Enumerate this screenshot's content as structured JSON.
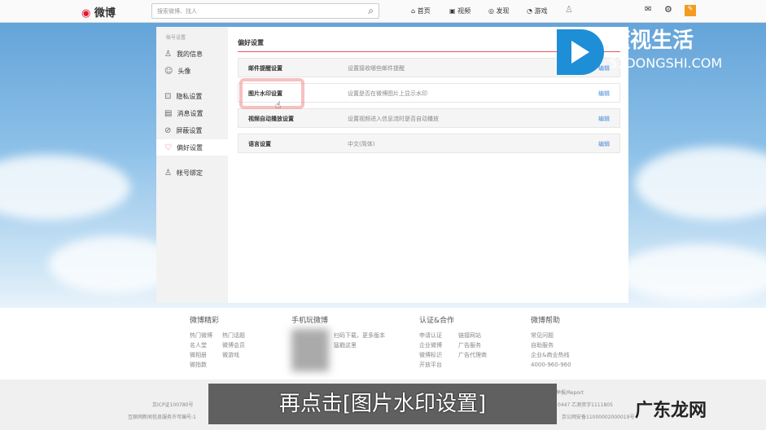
{
  "header": {
    "logo": "微博",
    "search_placeholder": "搜索微博、找人",
    "nav": [
      "首页",
      "视频",
      "发现",
      "游戏"
    ]
  },
  "sidebar": {
    "heading": "帐号设置",
    "items": [
      {
        "label": "我的信息",
        "icon": "user-icon"
      },
      {
        "label": "头像",
        "icon": "avatar-icon"
      },
      {
        "label": "隐私设置",
        "icon": "lock-icon"
      },
      {
        "label": "消息设置",
        "icon": "message-icon"
      },
      {
        "label": "屏蔽设置",
        "icon": "block-icon"
      },
      {
        "label": "偏好设置",
        "icon": "heart-icon"
      },
      {
        "label": "帐号绑定",
        "icon": "user-icon"
      }
    ]
  },
  "main": {
    "title": "偏好设置",
    "rows": [
      {
        "name": "邮件提醒设置",
        "desc": "设置接收哪些邮件提醒",
        "edit": "编辑"
      },
      {
        "name": "图片水印设置",
        "desc": "设置是否在微博图片上显示水印",
        "edit": "编辑"
      },
      {
        "name": "视频自动播放设置",
        "desc": "设置视频进入信息流时是否自动播放",
        "edit": "编辑"
      },
      {
        "name": "语言设置",
        "desc": "中文(简体)",
        "edit": "编辑"
      }
    ]
  },
  "footer": {
    "cols": [
      {
        "title": "微博精彩",
        "links": [
          "热门微博",
          "热门话题",
          "名人堂",
          "微博会员",
          "微相册",
          "微游戏",
          "微指数"
        ]
      },
      {
        "title": "手机玩微博",
        "links": [
          "扫码下载，更多版本",
          "猛戳这里"
        ]
      },
      {
        "title": "认证&合作",
        "links": [
          "申请认证",
          "链接网站",
          "企业微博",
          "广告服务",
          "微博标识",
          "广告代理商",
          "开放平台"
        ]
      },
      {
        "title": "微博帮助",
        "links": [
          "常见问题",
          "自助服务",
          "企业&商业热线",
          "4000-960-960"
        ]
      }
    ],
    "legal": [
      "京ICP证100780号",
      "互联网新闻信息服务许可编号:1",
      "举报/Report",
      "0447  乙测资字1111805",
      "京公网安备11000002000019号"
    ]
  },
  "subtitle": "再点击[图片水印设置]",
  "watermark": {
    "brand": "懂视生活",
    "domain": "51DONGSHI.COM",
    "corner": "广东龙网"
  }
}
